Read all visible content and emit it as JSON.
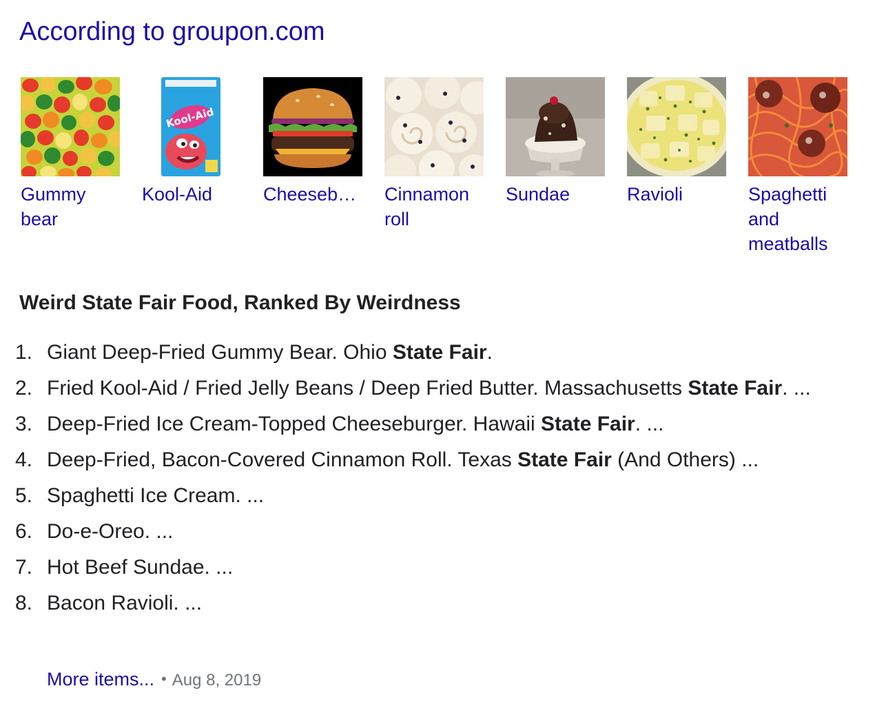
{
  "source": {
    "title": "According to groupon.com"
  },
  "carousel": {
    "items": [
      {
        "label": "Gummy bear",
        "icon": "gummy-bear-image"
      },
      {
        "label": "Kool-Aid",
        "icon": "kool-aid-packet-image"
      },
      {
        "label": "Cheeseb…",
        "icon": "cheeseburger-image"
      },
      {
        "label": "Cinnamon roll",
        "icon": "cinnamon-roll-image"
      },
      {
        "label": "Sundae",
        "icon": "sundae-image"
      },
      {
        "label": "Ravioli",
        "icon": "ravioli-image"
      },
      {
        "label": "Spaghetti and meatballs",
        "icon": "spaghetti-meatballs-image"
      }
    ],
    "packet_text": "Kool-Aid"
  },
  "list": {
    "heading": "Weird State Fair Food, Ranked By Weirdness",
    "items": [
      {
        "num": "1.",
        "before": "Giant Deep-Fried Gummy Bear. Ohio ",
        "bold": "State Fair",
        "after": "."
      },
      {
        "num": "2.",
        "before": "Fried Kool-Aid / Fried Jelly Beans / Deep Fried Butter. Massachusetts ",
        "bold": "State Fair",
        "after": ". ..."
      },
      {
        "num": "3.",
        "before": "Deep-Fried Ice Cream-Topped Cheeseburger. Hawaii ",
        "bold": "State Fair",
        "after": ". ..."
      },
      {
        "num": "4.",
        "before": "Deep-Fried, Bacon-Covered Cinnamon Roll. Texas ",
        "bold": "State Fair",
        "after": " (And Others) ..."
      },
      {
        "num": "5.",
        "before": "Spaghetti Ice Cream. ...",
        "bold": "",
        "after": ""
      },
      {
        "num": "6.",
        "before": "Do-e-Oreo. ...",
        "bold": "",
        "after": ""
      },
      {
        "num": "7.",
        "before": "Hot Beef Sundae. ...",
        "bold": "",
        "after": ""
      },
      {
        "num": "8.",
        "before": "Bacon Ravioli. ...",
        "bold": "",
        "after": ""
      }
    ]
  },
  "footer": {
    "more_label": "More items...",
    "separator": "•",
    "date": "Aug 8, 2019"
  },
  "colors": {
    "link": "#1a0dab",
    "text": "#202124",
    "meta": "#70757a"
  }
}
